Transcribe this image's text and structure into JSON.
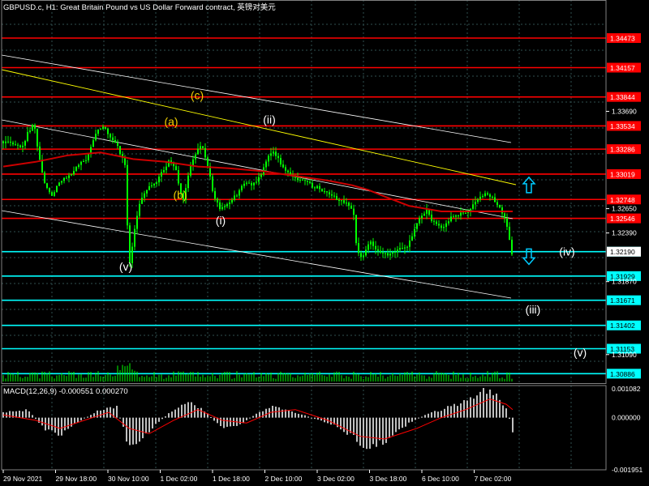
{
  "header": {
    "title": "GBPUSD.c, H1:  Great Britain Pound vs US Dollar Forward contract, 英镑对美元"
  },
  "colors": {
    "background": "#000000",
    "grid": "#2f4f4f",
    "candles": "#00ff00",
    "resistance": "#ff0000",
    "support": "#00ffff",
    "channel": "#ffffff",
    "trendline": "#ffff00",
    "moving_average": "#cc0000",
    "label_yellow": "#f0d000",
    "label_white": "#ffffff",
    "macd_hist": "#c0c0c0",
    "macd_signal": "#ff0000",
    "axis_text": "#ffffff",
    "arrow": "#00ccff"
  },
  "chart_data": [
    {
      "type": "candlestick",
      "name": "GBPUSD.c H1",
      "ylim": [
        1.30785,
        1.3488
      ],
      "x_labels": [
        "29 Nov 2021",
        "29 Nov 18:00",
        "30 Nov 10:00",
        "1 Dec 02:00",
        "1 Dec 18:00",
        "2 Dec 10:00",
        "3 Dec 02:00",
        "3 Dec 18:00",
        "6 Dec 10:00",
        "7 Dec 02:00"
      ],
      "price_scale_labels": [
        1.3369,
        1.3265,
        1.3239,
        1.3187,
        1.3109
      ],
      "current_price": 1.3219,
      "horizontal_levels": {
        "resistance": [
          1.34473,
          1.34157,
          1.33844,
          1.33534,
          1.33286,
          1.33019,
          1.32748,
          1.32546
        ],
        "support": [
          1.3219,
          1.31929,
          1.31671,
          1.31402,
          1.31153,
          1.30886
        ]
      },
      "close_path": [
        [
          0,
          1.3337
        ],
        [
          12,
          1.3335
        ],
        [
          22,
          1.333
        ],
        [
          30,
          1.3345
        ],
        [
          38,
          1.3355
        ],
        [
          44,
          1.332
        ],
        [
          52,
          1.329
        ],
        [
          60,
          1.328
        ],
        [
          70,
          1.3295
        ],
        [
          80,
          1.33
        ],
        [
          92,
          1.331
        ],
        [
          104,
          1.332
        ],
        [
          114,
          1.3345
        ],
        [
          124,
          1.3355
        ],
        [
          132,
          1.334
        ],
        [
          142,
          1.333
        ],
        [
          150,
          1.331
        ],
        [
          152,
          1.326
        ],
        [
          156,
          1.3205
        ],
        [
          162,
          1.3245
        ],
        [
          168,
          1.327
        ],
        [
          176,
          1.3285
        ],
        [
          186,
          1.329
        ],
        [
          196,
          1.3305
        ],
        [
          204,
          1.3315
        ],
        [
          212,
          1.331
        ],
        [
          216,
          1.329
        ],
        [
          222,
          1.3275
        ],
        [
          232,
          1.3315
        ],
        [
          244,
          1.3335
        ],
        [
          252,
          1.331
        ],
        [
          258,
          1.3285
        ],
        [
          266,
          1.3265
        ],
        [
          276,
          1.327
        ],
        [
          288,
          1.328
        ],
        [
          298,
          1.3295
        ],
        [
          308,
          1.329
        ],
        [
          318,
          1.33
        ],
        [
          326,
          1.332
        ],
        [
          334,
          1.3325
        ],
        [
          344,
          1.331
        ],
        [
          356,
          1.33
        ],
        [
          368,
          1.3295
        ],
        [
          380,
          1.329
        ],
        [
          392,
          1.3285
        ],
        [
          402,
          1.328
        ],
        [
          412,
          1.3275
        ],
        [
          424,
          1.327
        ],
        [
          432,
          1.326
        ],
        [
          436,
          1.322
        ],
        [
          442,
          1.321
        ],
        [
          452,
          1.323
        ],
        [
          462,
          1.322
        ],
        [
          474,
          1.3215
        ],
        [
          486,
          1.322
        ],
        [
          498,
          1.3225
        ],
        [
          506,
          1.324
        ],
        [
          514,
          1.3255
        ],
        [
          522,
          1.3265
        ],
        [
          530,
          1.325
        ],
        [
          540,
          1.3245
        ],
        [
          552,
          1.3255
        ],
        [
          566,
          1.326
        ],
        [
          576,
          1.3265
        ],
        [
          584,
          1.3275
        ],
        [
          594,
          1.328
        ],
        [
          604,
          1.3275
        ],
        [
          612,
          1.3265
        ],
        [
          618,
          1.3255
        ],
        [
          622,
          1.3245
        ],
        [
          626,
          1.322
        ],
        [
          628,
          1.3215
        ]
      ],
      "moving_average_path": [
        [
          0,
          1.331
        ],
        [
          40,
          1.3315
        ],
        [
          80,
          1.3322
        ],
        [
          120,
          1.3325
        ],
        [
          160,
          1.3318
        ],
        [
          200,
          1.3315
        ],
        [
          240,
          1.331
        ],
        [
          280,
          1.3308
        ],
        [
          320,
          1.3305
        ],
        [
          360,
          1.33
        ],
        [
          400,
          1.3295
        ],
        [
          430,
          1.329
        ],
        [
          450,
          1.3285
        ],
        [
          470,
          1.3278
        ],
        [
          500,
          1.3268
        ],
        [
          540,
          1.3262
        ],
        [
          580,
          1.3262
        ],
        [
          610,
          1.3262
        ],
        [
          628,
          1.3262
        ]
      ],
      "wave_labels": [
        {
          "text": "(c)",
          "x_index": 241,
          "price": 1.3382,
          "color": "yellow"
        },
        {
          "text": "(a)",
          "x_index": 209,
          "price": 1.3354,
          "color": "yellow"
        },
        {
          "text": "(b)",
          "x_index": 220,
          "price": 1.32755,
          "color": "yellow"
        },
        {
          "text": "(ii)",
          "x_index": 330,
          "price": 1.3356,
          "color": "white"
        },
        {
          "text": "(i)",
          "x_index": 270,
          "price": 1.3248,
          "color": "white"
        },
        {
          "text": "(v)",
          "x_index": 153,
          "price": 1.3199,
          "color": "white"
        },
        {
          "text": "(iv)",
          "x_index": 697,
          "price": 1.3215,
          "color": "white"
        },
        {
          "text": "(iii)",
          "x_index": 655,
          "price": 1.3153,
          "color": "white"
        },
        {
          "text": "(v)",
          "x_index": 713,
          "price": 1.3107,
          "color": "white"
        }
      ],
      "arrows": [
        {
          "direction": "up",
          "x_index": 650,
          "price": 1.3289
        },
        {
          "direction": "down",
          "x_index": 650,
          "price": 1.3215
        }
      ]
    },
    {
      "type": "bar",
      "name": "MACD(12,26,9)",
      "title": "MACD(12,26,9) -0.000551 0.000270",
      "ylim": [
        -0.00195,
        0.0012
      ],
      "y_labels": [
        0.001082,
        0.0,
        -0.001951
      ],
      "histogram_path": [
        [
          0,
          0.0002
        ],
        [
          30,
          0.0003
        ],
        [
          50,
          -0.0004
        ],
        [
          70,
          -0.0007
        ],
        [
          90,
          -0.0002
        ],
        [
          120,
          0.0003
        ],
        [
          140,
          0.0004
        ],
        [
          155,
          -0.0011
        ],
        [
          170,
          -0.0008
        ],
        [
          190,
          -0.0002
        ],
        [
          210,
          0.0003
        ],
        [
          230,
          0.0006
        ],
        [
          250,
          0.0002
        ],
        [
          270,
          -0.0004
        ],
        [
          290,
          -0.0003
        ],
        [
          310,
          0.0001
        ],
        [
          330,
          0.0004
        ],
        [
          350,
          0.0003
        ],
        [
          380,
          0.0
        ],
        [
          410,
          -0.0003
        ],
        [
          430,
          -0.0007
        ],
        [
          450,
          -0.0012
        ],
        [
          470,
          -0.0009
        ],
        [
          500,
          -0.0002
        ],
        [
          520,
          0.0001
        ],
        [
          540,
          0.0003
        ],
        [
          570,
          0.0006
        ],
        [
          590,
          0.001
        ],
        [
          605,
          0.0009
        ],
        [
          620,
          0.0004
        ],
        [
          628,
          -0.0005
        ]
      ],
      "signal_path": [
        [
          0,
          0.0001
        ],
        [
          40,
          -0.0001
        ],
        [
          70,
          -0.0004
        ],
        [
          100,
          -0.0001
        ],
        [
          130,
          0.0002
        ],
        [
          155,
          -0.0004
        ],
        [
          180,
          -0.0006
        ],
        [
          210,
          -0.0001
        ],
        [
          240,
          0.0003
        ],
        [
          270,
          -0.0001
        ],
        [
          300,
          -0.0002
        ],
        [
          330,
          0.0002
        ],
        [
          360,
          0.0003
        ],
        [
          400,
          -0.0001
        ],
        [
          440,
          -0.0007
        ],
        [
          470,
          -0.0008
        ],
        [
          510,
          -0.0004
        ],
        [
          540,
          0.0
        ],
        [
          570,
          0.0003
        ],
        [
          600,
          0.0007
        ],
        [
          620,
          0.0005
        ],
        [
          628,
          0.0003
        ]
      ]
    }
  ]
}
